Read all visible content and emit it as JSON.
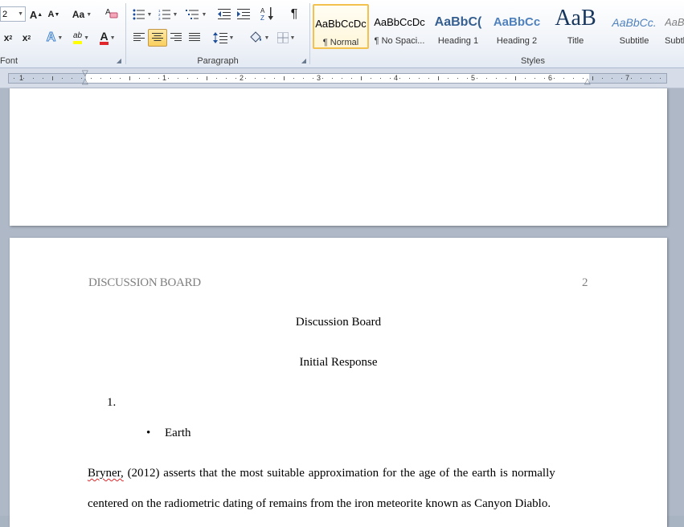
{
  "ribbon": {
    "font_group": {
      "label": "Font",
      "size_value": "2",
      "grow_font": "A",
      "shrink_font": "A",
      "change_case": "Aa",
      "subscript": "x",
      "superscript": "x",
      "text_effects": "A",
      "highlight": "ab",
      "font_color": "A"
    },
    "paragraph_group": {
      "label": "Paragraph",
      "pilcrow": "¶"
    },
    "styles_group": {
      "label": "Styles",
      "items": [
        {
          "sample": "AaBbCcDc",
          "name": "¶ Normal"
        },
        {
          "sample": "AaBbCcDc",
          "name": "¶ No Spaci..."
        },
        {
          "sample": "AaBbC(",
          "name": "Heading 1"
        },
        {
          "sample": "AaBbCc",
          "name": "Heading 2"
        },
        {
          "sample": "AaB",
          "name": "Title"
        },
        {
          "sample": "AaBbCc.",
          "name": "Subtitle"
        },
        {
          "sample": "AaBl",
          "name": "Subtl"
        }
      ]
    }
  },
  "ruler": {
    "numbers": [
      "1",
      "1",
      "2",
      "3",
      "4",
      "5",
      "6",
      "7"
    ]
  },
  "document": {
    "header_left": "DISCUSSION BOARD",
    "header_right": "2",
    "title": "Discussion Board",
    "subtitle": "Initial Response",
    "numbered_item": "1.",
    "bullet_item": "Earth",
    "para_word1": "Bryner,",
    "para_line1_rest": " (2012) asserts that the most suitable approximation for the age of the earth is normally",
    "para_line2": "centered on the radiometric dating of remains from the iron meteorite known as Canyon Diablo."
  },
  "colors": {
    "accent_selected": "#f2c14e",
    "heading_blue": "#365f91",
    "title_blue": "#17365d",
    "highlight_yellow": "#ffff00",
    "font_color_red": "#e0262a"
  }
}
